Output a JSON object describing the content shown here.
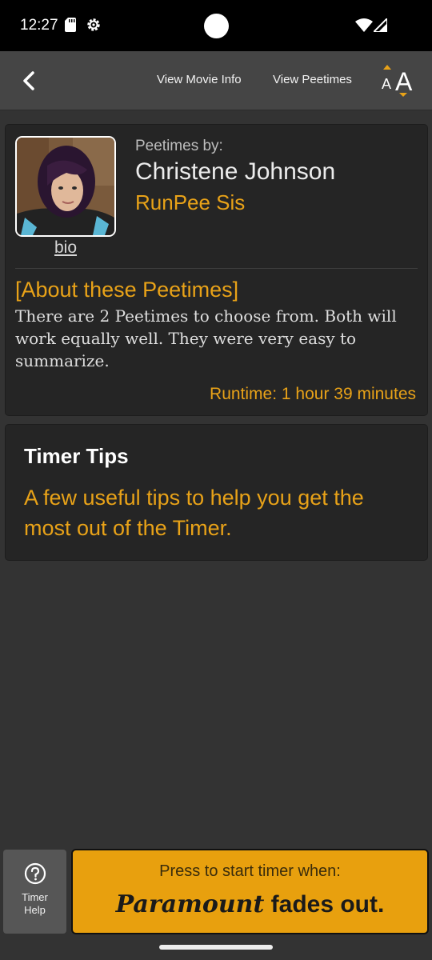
{
  "status_bar": {
    "time": "12:27",
    "icons": [
      "sd-card-icon",
      "gear-icon",
      "wifi-icon",
      "signal-icon"
    ]
  },
  "nav": {
    "back_icon": "chevron-left-icon",
    "links": [
      "View Movie Info",
      "View Peetimes"
    ],
    "font_size_icon": "font-size-icon"
  },
  "author": {
    "label": "Peetimes by:",
    "name": "Christene Johnson",
    "role": "RunPee Sis",
    "bio_link": "bio"
  },
  "about": {
    "title": "[About these Peetimes]",
    "text": "There are 2 Peetimes to choose from. Both will work equally well. They were very easy to summarize.",
    "runtime": "Runtime: 1 hour 39 minutes"
  },
  "tips": {
    "title": "Timer Tips",
    "text": "A few useful tips to help you get the most out of the Timer."
  },
  "bottom": {
    "help_label_line1": "Timer",
    "help_label_line2": "Help",
    "start_prompt": "Press to start timer when:",
    "cue_name": "Paramount",
    "cue_action": "fades out."
  },
  "colors": {
    "accent": "#e8a218",
    "button": "#e8a00e",
    "background": "#333333",
    "card": "#252525"
  }
}
